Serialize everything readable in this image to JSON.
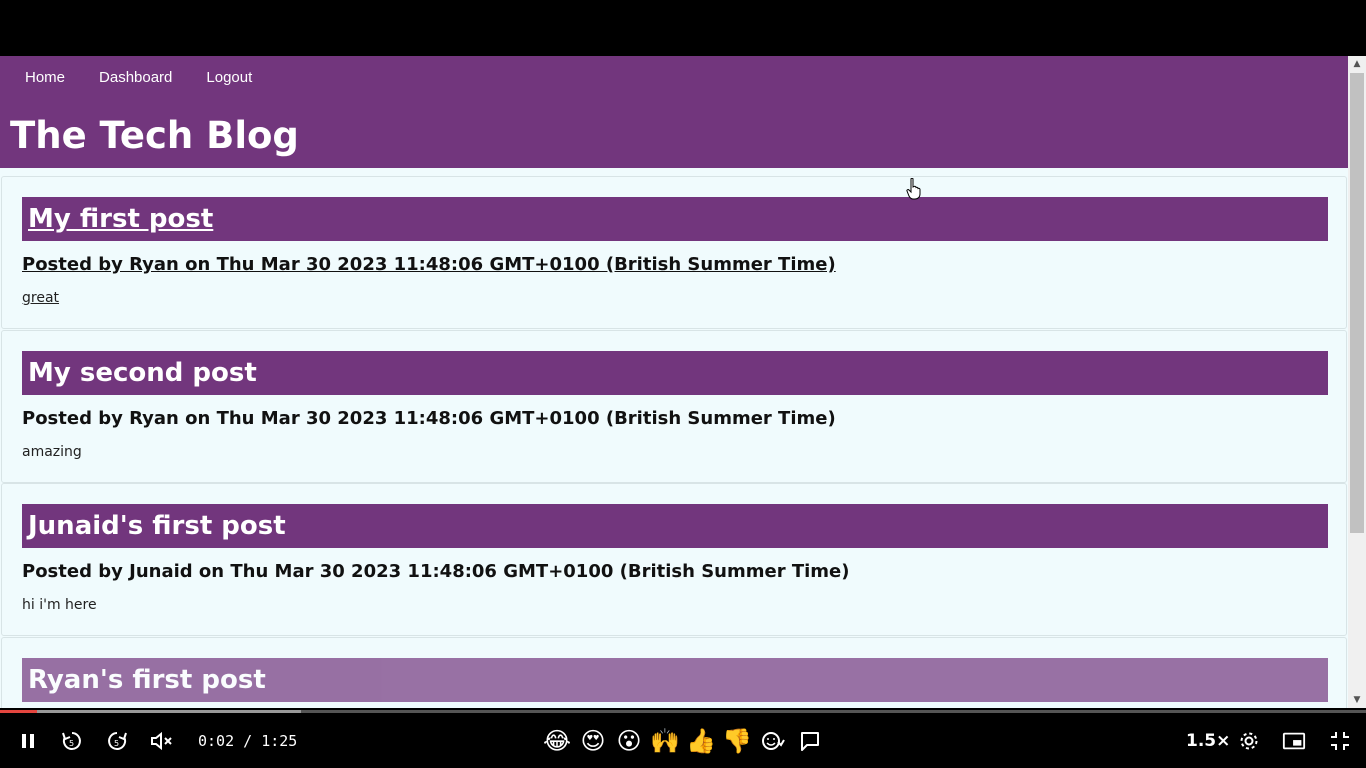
{
  "nav": {
    "home": "Home",
    "dashboard": "Dashboard",
    "logout": "Logout"
  },
  "site_title": "The Tech Blog",
  "posts": [
    {
      "title": "My first post",
      "meta": "Posted by Ryan on Thu Mar 30 2023 11:48:06 GMT+0100 (British Summer Time)",
      "body": "great"
    },
    {
      "title": "My second post",
      "meta": "Posted by Ryan on Thu Mar 30 2023 11:48:06 GMT+0100 (British Summer Time)",
      "body": "amazing"
    },
    {
      "title": "Junaid's first post",
      "meta": "Posted by Junaid on Thu Mar 30 2023 11:48:06 GMT+0100 (British Summer Time)",
      "body": "hi i'm here"
    },
    {
      "title": "Ryan's first post"
    }
  ],
  "player": {
    "time": "0:02 / 1:25",
    "speed": "1.5×",
    "progress_played_fraction": 0.027,
    "progress_buffered_fraction": 0.22,
    "emojis": [
      "😂",
      "😍",
      "😮",
      "🙌",
      "👍",
      "👎"
    ],
    "icons": [
      "pause-icon",
      "rewind-5-icon",
      "forward-5-icon",
      "mute-icon",
      "add-emoji-icon",
      "comment-icon",
      "settings-icon",
      "miniplayer-icon",
      "exit-fullscreen-icon"
    ]
  },
  "colors": {
    "header": "#72367d",
    "page_bg": "#f0fbfd",
    "progress": "#e5463f"
  }
}
